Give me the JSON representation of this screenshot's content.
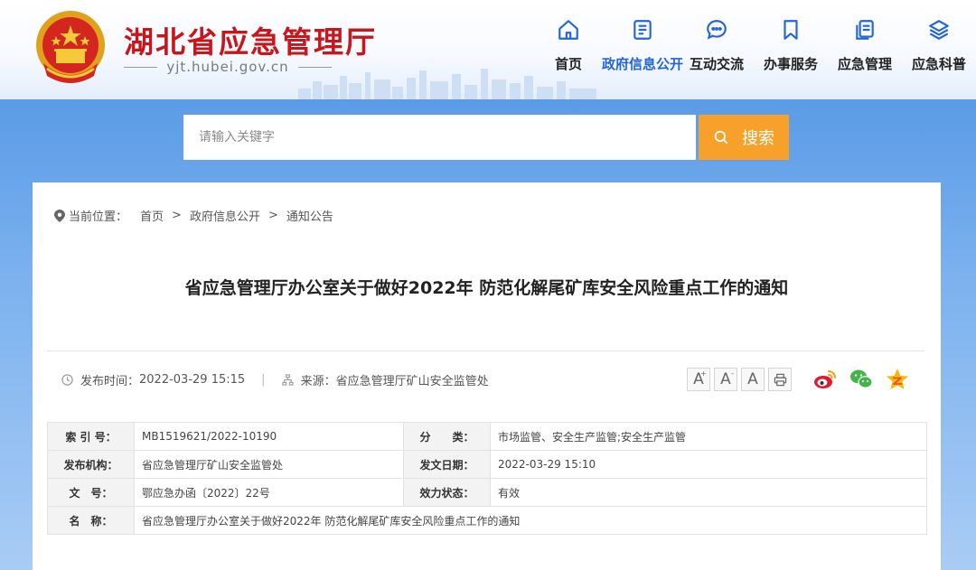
{
  "header": {
    "site_title": "湖北省应急管理厅",
    "site_domain": "yjt.hubei.gov.cn",
    "nav": [
      {
        "label": "首页",
        "icon": "home-icon",
        "active": false
      },
      {
        "label": "政府信息公开",
        "icon": "document-icon",
        "active": true
      },
      {
        "label": "互动交流",
        "icon": "chat-bubble-icon",
        "active": false
      },
      {
        "label": "办事服务",
        "icon": "bookmark-icon",
        "active": false
      },
      {
        "label": "应急管理",
        "icon": "files-icon",
        "active": false
      },
      {
        "label": "应急科普",
        "icon": "layers-icon",
        "active": false
      }
    ]
  },
  "search": {
    "placeholder": "请输入关键字",
    "button_label": "搜索"
  },
  "breadcrumb": {
    "label": "当前位置：",
    "items": [
      "首页",
      "政府信息公开",
      "通知公告"
    ],
    "separator": ">"
  },
  "article": {
    "title": "省应急管理厅办公室关于做好2022年 防范化解尾矿库安全风险重点工作的通知",
    "publish_label": "发布时间：",
    "publish_time": "2022-03-29 15:15",
    "source_label": "来源：",
    "source": "省应急管理厅矿山安全监管处",
    "separator": "|"
  },
  "tools": {
    "font_large": "A",
    "font_small": "A",
    "font_default": "A",
    "print_icon": "printer-icon",
    "share_icons": [
      "weibo-icon",
      "wechat-icon",
      "qzone-star-icon"
    ]
  },
  "info_table": {
    "index_label": "索 引 号：",
    "index_value": "MB1519621/2022-10190",
    "category_label": "分　　类：",
    "category_value": "市场监管、安全生产监管;安全生产监管",
    "publisher_label": "发布机构：",
    "publisher_value": "省应急管理厅矿山安全监管处",
    "date_label": "发文日期：",
    "date_value": "2022-03-29 15:10",
    "docno_label": "文　号：",
    "docno_value": "鄂应急办函〔2022〕22号",
    "status_label": "效力状态：",
    "status_value": "有效",
    "name_label": "名　称：",
    "name_value": "省应急管理厅办公室关于做好2022年 防范化解尾矿库安全风险重点工作的通知"
  },
  "colors": {
    "brand_red": "#c8161d",
    "nav_active": "#2466d6",
    "search_button": "#f7a12b",
    "band_blue": "#5e9ee6"
  }
}
